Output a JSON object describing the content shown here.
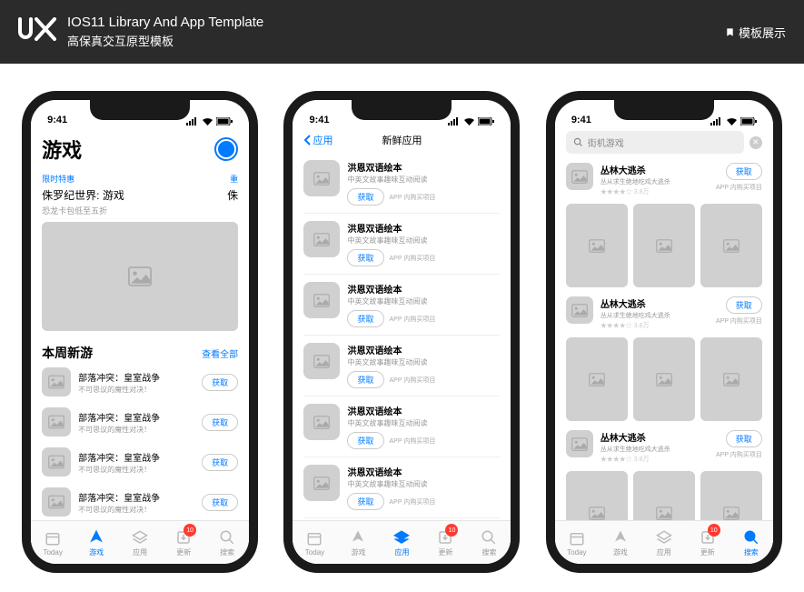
{
  "header": {
    "logo": "UX",
    "title": "IOS11 Library And App Template",
    "subtitle": "高保真交互原型模板",
    "showcase": "模板展示"
  },
  "status": {
    "time": "9:41"
  },
  "tabs": {
    "today": "Today",
    "games": "游戏",
    "apps": "应用",
    "updates": "更新",
    "search": "搜索",
    "badge": "10"
  },
  "common": {
    "get": "获取",
    "iap": "APP 内购买项目",
    "see_all": "查看全部"
  },
  "p1": {
    "title": "游戏",
    "promo_tag": "限时特惠",
    "promo_tag2": "重",
    "promo_title": "侏罗纪世界: 游戏",
    "promo_sub": "恐龙卡包低至五折",
    "promo_title2": "侏",
    "section": "本周新游",
    "items": [
      {
        "name": "部落冲突：皇室战争",
        "desc": "不可思议的魔性对决！"
      },
      {
        "name": "部落冲突：皇室战争",
        "desc": "不可思议的魔性对决！"
      },
      {
        "name": "部落冲突：皇室战争",
        "desc": "不可思议的魔性对决！"
      },
      {
        "name": "部落冲突：皇室战争",
        "desc": "不可思议的魔性对决！"
      }
    ]
  },
  "p2": {
    "back": "应用",
    "title": "新鲜应用",
    "items": [
      {
        "name": "洪恩双语绘本",
        "desc": "中英文故事趣味互动阅读"
      },
      {
        "name": "洪恩双语绘本",
        "desc": "中英文故事趣味互动阅读"
      },
      {
        "name": "洪恩双语绘本",
        "desc": "中英文故事趣味互动阅读"
      },
      {
        "name": "洪恩双语绘本",
        "desc": "中英文故事趣味互动阅读"
      },
      {
        "name": "洪恩双语绘本",
        "desc": "中英文故事趣味互动阅读"
      },
      {
        "name": "洪恩双语绘本",
        "desc": "中英文故事趣味互动阅读"
      }
    ]
  },
  "p3": {
    "search": "街机游戏",
    "items": [
      {
        "name": "丛林大逃杀",
        "desc": "丛从求生绝地吃鸡大逃杀",
        "rating": "★★★★☆ 3.8万"
      },
      {
        "name": "丛林大逃杀",
        "desc": "丛从求生绝地吃鸡大逃杀",
        "rating": "★★★★☆ 3.8万"
      },
      {
        "name": "丛林大逃杀",
        "desc": "丛从求生绝地吃鸡大逃杀",
        "rating": "★★★★☆ 3.8万"
      }
    ]
  }
}
